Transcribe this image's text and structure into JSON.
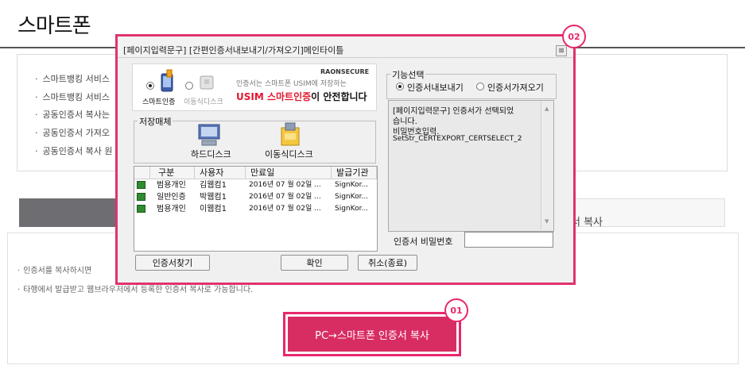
{
  "page": {
    "title": "스마트폰",
    "bullets": [
      "스마트뱅킹 서비스",
      "스마트뱅킹 서비스",
      "공동인증서 복사는",
      "공동인증서 가져오",
      "공동인증서 복사 원"
    ],
    "copy_bar_text": "서 복사",
    "notes": [
      "인증서를 복사하시면",
      "타행에서 발급받고 웹브라우저에서 등록한 인증서 복사로 가능합니다."
    ],
    "cta_label": "PC→스마트폰 인증서 복사",
    "badges": {
      "cta": "01",
      "dialog": "02"
    }
  },
  "dialog": {
    "title": "[페이지입력문구] [간편인증서내보내기/가져오기]메인타이틀",
    "close": "⊠",
    "banner": {
      "option_smartphone": "스마트인증",
      "option_usb": "이동식디스크",
      "brand": "RAONSECURE",
      "line1": "인증서는 스마트폰 USIM에 저장하는",
      "line2_highlight": "USIM 스마트인증",
      "line2_rest": "이 안전합니다"
    },
    "storage": {
      "label": "저장매체",
      "hdd": "하드디스크",
      "usb": "이동식디스크"
    },
    "list": {
      "headers": [
        "구분",
        "사용자",
        "만료일",
        "발급기관"
      ],
      "rows": [
        [
          "범용개인",
          "김웹컴1",
          "2016년 07 월 02일 ...",
          "SignKor..."
        ],
        [
          "일반인증",
          "박웹컴1",
          "2016년 07 월 02일 ...",
          "SignKor..."
        ],
        [
          "범용개인",
          "이웹컴1",
          "2016년 07 월 02일 ...",
          "SignKor..."
        ]
      ]
    },
    "function": {
      "label": "기능선택",
      "export": "인증서내보내기",
      "import": "인증서가져오기",
      "selected": "인증서내보내기"
    },
    "message_lines": [
      "[페이지입력문구] 인증서가 선택되었",
      "습니다.",
      "비밀번호입력.",
      "SetStr_CERTEXPORT_CERTSELECT_2"
    ],
    "password_label": "인증서 비밀번호",
    "password_value": "",
    "buttons": {
      "find": "인증서찾기",
      "ok": "확인",
      "cancel": "취소(종료)"
    }
  },
  "colors": {
    "accent": "#e8276d",
    "cta_fill": "#d82d63",
    "usim_red": "#e4162f"
  }
}
